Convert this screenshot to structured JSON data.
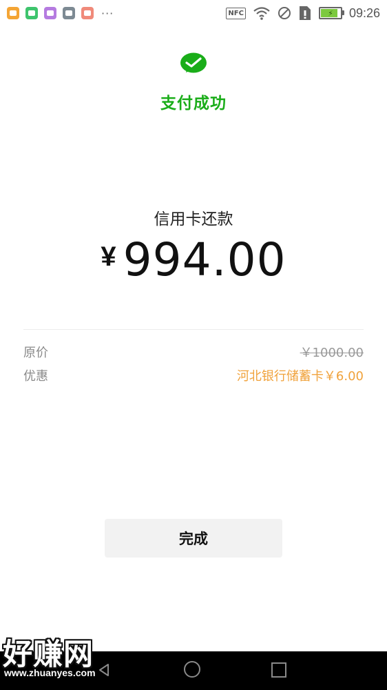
{
  "status_bar": {
    "time": "09:26",
    "nfc_label": "NFC",
    "notification_icons": [
      "orange-app-icon",
      "green-app-icon",
      "purple-app-icon",
      "gray-app-icon",
      "red-app-icon"
    ],
    "more": "···"
  },
  "result": {
    "status_text": "支付成功",
    "accent_color": "#1aad19"
  },
  "payment": {
    "merchant": "信用卡还款",
    "currency_symbol": "¥",
    "amount": "994.00"
  },
  "details": {
    "original_label": "原价",
    "original_value": "￥1000.00",
    "discount_label": "优惠",
    "discount_value": "河北银行储蓄卡￥6.00",
    "discount_color": "#f0a23b"
  },
  "actions": {
    "done_label": "完成"
  },
  "watermark": {
    "title": "好赚网",
    "url": "www.zhuanyes.com"
  }
}
